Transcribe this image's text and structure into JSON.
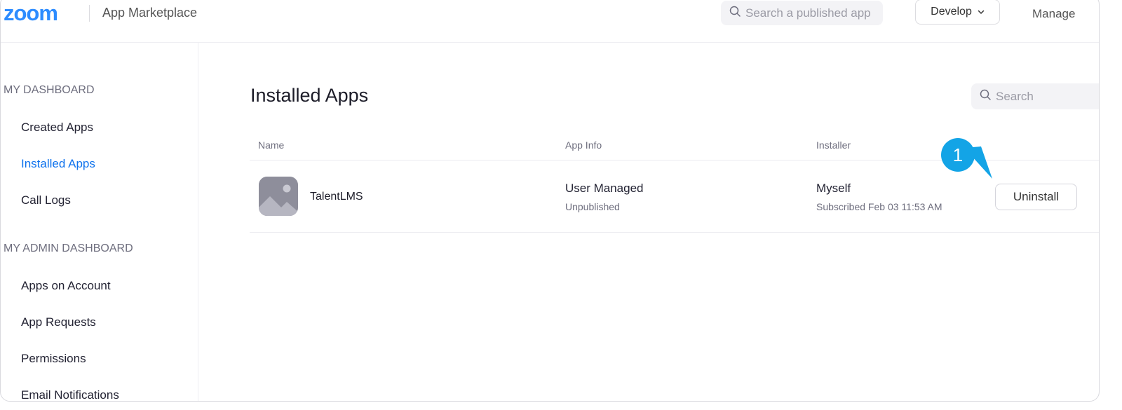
{
  "header": {
    "logo": "zoom",
    "title": "App Marketplace",
    "search_placeholder": "Search a published app",
    "develop_label": "Develop",
    "manage_label": "Manage"
  },
  "sidebar": {
    "dashboard_heading": "MY DASHBOARD",
    "dashboard_items": [
      {
        "label": "Created Apps"
      },
      {
        "label": "Installed Apps",
        "active": true
      },
      {
        "label": "Call Logs"
      }
    ],
    "admin_heading": "MY ADMIN DASHBOARD",
    "admin_items": [
      {
        "label": "Apps on Account"
      },
      {
        "label": "App Requests"
      },
      {
        "label": "Permissions"
      },
      {
        "label": "Email Notifications"
      }
    ]
  },
  "main": {
    "title": "Installed Apps",
    "search_placeholder": "Search",
    "columns": [
      "Name",
      "App Info",
      "Installer"
    ],
    "rows": [
      {
        "name": "TalentLMS",
        "app_info": "User Managed",
        "app_status": "Unpublished",
        "installer": "Myself",
        "subscribed": "Subscribed Feb 03 11:53 AM",
        "action_label": "Uninstall"
      }
    ]
  },
  "annotation": {
    "step_number": "1"
  },
  "colors": {
    "brand": "#2d8cff",
    "active_nav": "#0e72ed",
    "marker": "#13a4e6"
  },
  "icons": [
    "search-icon",
    "chevron-down-icon",
    "image-placeholder-icon"
  ]
}
